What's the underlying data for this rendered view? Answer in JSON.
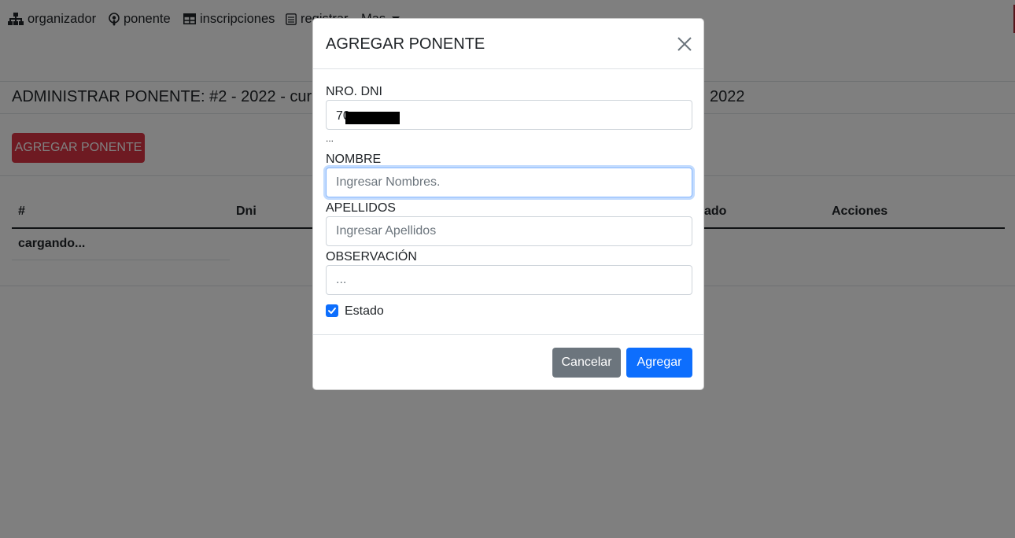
{
  "nav": {
    "items": [
      {
        "label": "organizador",
        "icon": "sitemap-icon"
      },
      {
        "label": "ponente",
        "icon": "podcast-icon"
      },
      {
        "label": "inscripciones",
        "icon": "table-icon"
      },
      {
        "label": "registrar",
        "icon": "list-alt-icon"
      },
      {
        "label": "Mas",
        "icon": "caret-down-icon"
      }
    ]
  },
  "page": {
    "title": "ADMINISTRAR PONENTE: #2 - 2022 - curs",
    "title_tail": "2022",
    "add_button": "AGREGAR PONENTE",
    "table": {
      "headers": [
        "#",
        "Dni",
        "ado",
        "Acciones"
      ],
      "loading": "cargando..."
    }
  },
  "modal": {
    "title": "AGREGAR PONENTE",
    "dni_label": "NRO. DNI",
    "dni_value": "70",
    "dni_hint": "...",
    "nombre_label": "NOMBRE",
    "nombre_placeholder": "Ingresar Nombres.",
    "apellidos_label": "APELLIDOS",
    "apellidos_placeholder": "Ingresar Apellidos",
    "observacion_label": "OBSERVACIÓN",
    "observacion_placeholder": "...",
    "estado_label": "Estado",
    "estado_checked": true,
    "cancel_label": "Cancelar",
    "submit_label": "Agregar"
  },
  "colors": {
    "primary": "#0d6efd",
    "danger": "#dc3545",
    "secondary": "#6c757d"
  }
}
